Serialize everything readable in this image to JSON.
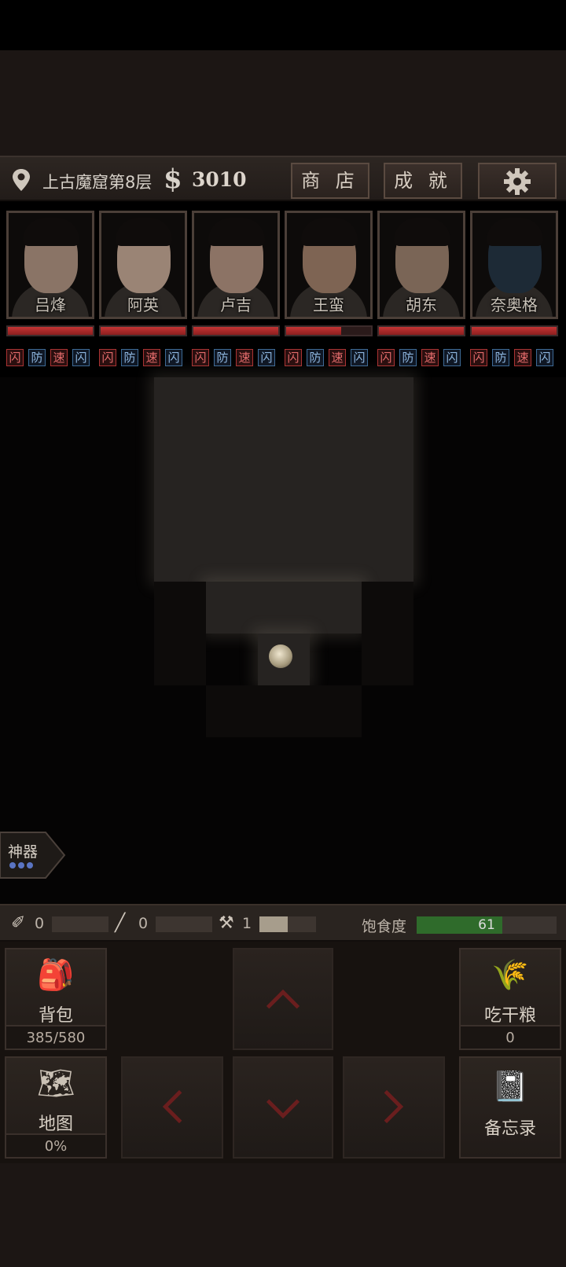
{
  "header": {
    "location": "上古魔窟第8层",
    "currency_symbol": "$",
    "gold": "3010",
    "shop_label": "商 店",
    "achievements_label": "成 就",
    "settings_icon": "gear-icon"
  },
  "party": [
    {
      "name": "吕烽",
      "hp": 1.0,
      "tags": [
        "闪",
        "防",
        "速",
        "闪"
      ]
    },
    {
      "name": "阿英",
      "hp": 1.0,
      "tags": [
        "闪",
        "防",
        "速",
        "闪"
      ]
    },
    {
      "name": "卢吉",
      "hp": 1.0,
      "tags": [
        "闪",
        "防",
        "速",
        "闪"
      ]
    },
    {
      "name": "王蛮",
      "hp": 0.65,
      "tags": [
        "闪",
        "防",
        "速",
        "闪"
      ]
    },
    {
      "name": "胡东",
      "hp": 1.0,
      "tags": [
        "闪",
        "防",
        "速",
        "闪"
      ]
    },
    {
      "name": "奈奥格",
      "hp": 1.0,
      "tags": [
        "闪",
        "防",
        "速",
        "闪"
      ]
    }
  ],
  "artifact": {
    "label": "神器"
  },
  "status": {
    "tools": [
      {
        "icon": "torch-icon",
        "count": "0",
        "fill": 0
      },
      {
        "icon": "pick-icon",
        "count": "0",
        "fill": 0
      },
      {
        "icon": "shovel-icon",
        "count": "1",
        "fill": 0.5
      }
    ],
    "satiety_label": "饱食度",
    "satiety_value": "61",
    "satiety_fill": 0.61
  },
  "controls": {
    "backpack_label": "背包",
    "backpack_capacity": "385/580",
    "eat_label": "吃干粮",
    "eat_count": "0",
    "map_label": "地图",
    "map_progress": "0%",
    "memo_label": "备忘录",
    "colors": {
      "accent_red": "#c43434",
      "satiety_green": "#2f6b2b"
    }
  }
}
